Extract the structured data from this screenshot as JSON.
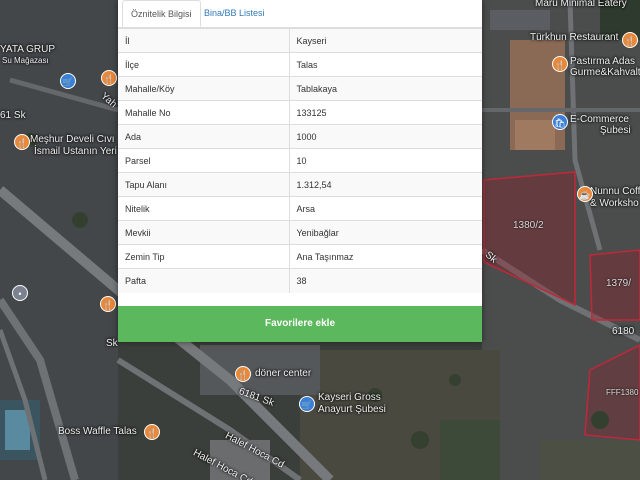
{
  "tabs": [
    {
      "label": "Öznitelik Bilgisi"
    },
    {
      "label": "Bina/BB Listesi"
    }
  ],
  "attributes": [
    {
      "key": "İl",
      "value": "Kayseri"
    },
    {
      "key": "İlçe",
      "value": "Talas"
    },
    {
      "key": "Mahalle/Köy",
      "value": "Tablakaya"
    },
    {
      "key": "Mahalle No",
      "value": "133125"
    },
    {
      "key": "Ada",
      "value": "1000"
    },
    {
      "key": "Parsel",
      "value": "10"
    },
    {
      "key": "Tapu Alanı",
      "value": "1.312,54"
    },
    {
      "key": "Nitelik",
      "value": "Arsa"
    },
    {
      "key": "Mevkii",
      "value": "Yenibağlar"
    },
    {
      "key": "Zemin Tip",
      "value": "Ana Taşınmaz"
    },
    {
      "key": "Pafta",
      "value": "38"
    }
  ],
  "favorite_button": "Favorilere ekle",
  "map": {
    "labels": {
      "maru": "Maru Minimal Eatery",
      "turkhun": "Türkhun Restaurant",
      "pastirma": "Pastırma Adas",
      "gurme": "Gurme&Kahvalt",
      "eticaret": "E-Commerce",
      "subesi": "Şubesi",
      "nunnu": "Nunnu Coff",
      "workshop": "& Worksho",
      "yata": "YATA GRUP",
      "magaza": "Su Mağazası",
      "meshur": "Meşhur Develi Cıvı",
      "ismail": "İsmail Ustanın Yeri",
      "yahsk": "Yah",
      "sk61": "61 Sk",
      "sk": "Sk",
      "doner": "döner center",
      "kayseri_gross": "Kayseri Gross",
      "anayurt": "Anayurt Şubesi",
      "boss": "Boss Waffle Talas",
      "halef1": "Halef Hoca Cd",
      "halef2": "Halef Hoca Cd",
      "sk6180": "6180",
      "sk6181": "6181 Sk",
      "sk2": "Sk",
      "parcel1": "1380/2",
      "parcel2": "1379/",
      "parcel3": "FFF1380"
    }
  },
  "colors": {
    "tab_active_text": "#555555",
    "tab_link": "#337ab7",
    "button_green": "#5cb85c",
    "parcel_outline": "#c0283a"
  }
}
